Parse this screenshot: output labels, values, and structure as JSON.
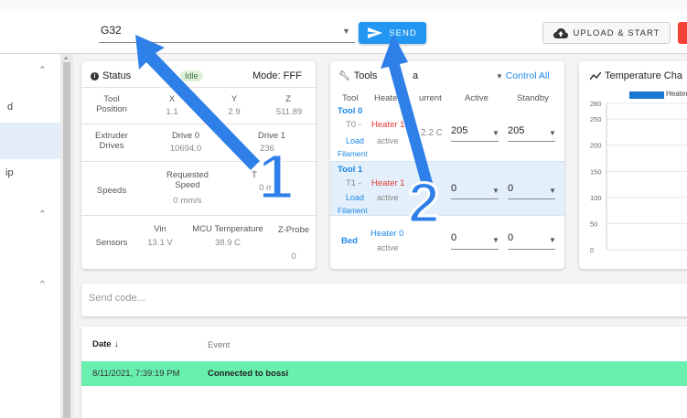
{
  "toolbar": {
    "code_value": "G32",
    "send_label": "SEND",
    "upload_label": "UPLOAD & START"
  },
  "sidebar": {
    "items": [
      {
        "label": "d"
      },
      {
        "label": "ip"
      }
    ]
  },
  "status": {
    "title": "Status",
    "state_badge": "Idle",
    "mode": "Mode: FFF",
    "tool_position": {
      "label": "Tool Position",
      "axes": [
        {
          "name": "X",
          "value": "1.1"
        },
        {
          "name": "Y",
          "value": "2.9"
        },
        {
          "name": "Z",
          "value": "511.89"
        }
      ]
    },
    "extruder_drives": {
      "label": "Extruder Drives",
      "drives": [
        {
          "name": "Drive 0",
          "value": "10694.0"
        },
        {
          "name": "Drive 1",
          "value": "236"
        }
      ]
    },
    "speeds": {
      "label": "Speeds",
      "requested_label": "Requested Speed",
      "requested_value": "0 mm/s",
      "top_label": "T",
      "top_value": "0 m"
    },
    "sensors": {
      "label": "Sensors",
      "vin_label": "Vin",
      "vin_value": "13.1 V",
      "mcu_label": "MCU Temperature",
      "mcu_value": "38.9 C",
      "zprobe_label": "Z-Probe",
      "zprobe_value": "0"
    }
  },
  "tools": {
    "title": "Tools",
    "title_suffix": "a",
    "control_all": "Control All",
    "headers": {
      "tool": "Tool",
      "heater": "Heater",
      "current": "urrent",
      "active": "Active",
      "standby": "Standby"
    },
    "rows": [
      {
        "name": "Tool 0",
        "id": "T0 -",
        "heater": "Heater 1",
        "load": "Load",
        "state": "active",
        "filament": "Filament",
        "current": "2.2 C",
        "active": "205",
        "standby": "205"
      },
      {
        "name": "Tool 1",
        "id": "T1 -",
        "heater": "Heater 1",
        "load": "Load",
        "state": "active",
        "filament": "Filament",
        "current": "",
        "active": "0",
        "standby": "0"
      }
    ],
    "bed": {
      "name": "Bed",
      "heater": "Heater 0",
      "state": "active",
      "active": "0",
      "standby": "0"
    }
  },
  "temperature": {
    "title": "Temperature Cha",
    "legend": "Heater",
    "y_ticks": [
      "280",
      "250",
      "200",
      "150",
      "100",
      "50",
      "0"
    ],
    "chart_data": {
      "type": "line",
      "title": "Temperature Cha",
      "series": [
        {
          "name": "Heater",
          "values": []
        }
      ],
      "ylim": [
        0,
        280
      ],
      "y_ticks": [
        0,
        50,
        100,
        150,
        200,
        250,
        280
      ]
    }
  },
  "console": {
    "placeholder": "Send code..."
  },
  "events": {
    "date_header": "Date",
    "event_header": "Event",
    "rows": [
      {
        "date": "8/11/2021, 7:39:19 PM",
        "event": "Connected to bossi"
      }
    ]
  },
  "annotations": {
    "marker_1": "1",
    "marker_2": "2"
  },
  "colors": {
    "accent": "#2196f3",
    "heater_red": "#e53935",
    "event_green": "#69f0ae",
    "arrow_blue": "#2f7fe8"
  }
}
